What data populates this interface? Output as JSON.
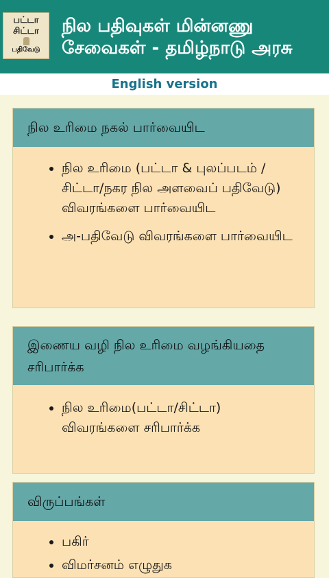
{
  "header": {
    "logo_lines": [
      "பட்டா",
      "சிட்டா",
      "பதிவேடு"
    ],
    "title_line1": "நில பதிவுகள் மின்னணு",
    "title_line2": "சேவைகள் - தமிழ்நாடு அரசு"
  },
  "english_link": "English version",
  "cards": [
    {
      "title": "நில உரிமை நகல் பார்வையிட",
      "items": [
        "நில உரிமை (பட்டா & புலப்படம் / சிட்டா/நகர நில அளவைப் பதிவேடு) விவரங்களை பார்வையிட",
        "அ-பதிவேடு விவரங்களை பார்வையிட"
      ]
    },
    {
      "title": "இணைய வழி நில உரிமை வழங்கியதை சரிபார்க்க",
      "items": [
        "நில உரிமை(பட்டா/சிட்டா) விவரங்களை சரிபார்க்க"
      ]
    },
    {
      "title": "விருப்பங்கள்",
      "items": [
        "பகிர்",
        "விமர்சனம் எழுதுக"
      ]
    }
  ]
}
